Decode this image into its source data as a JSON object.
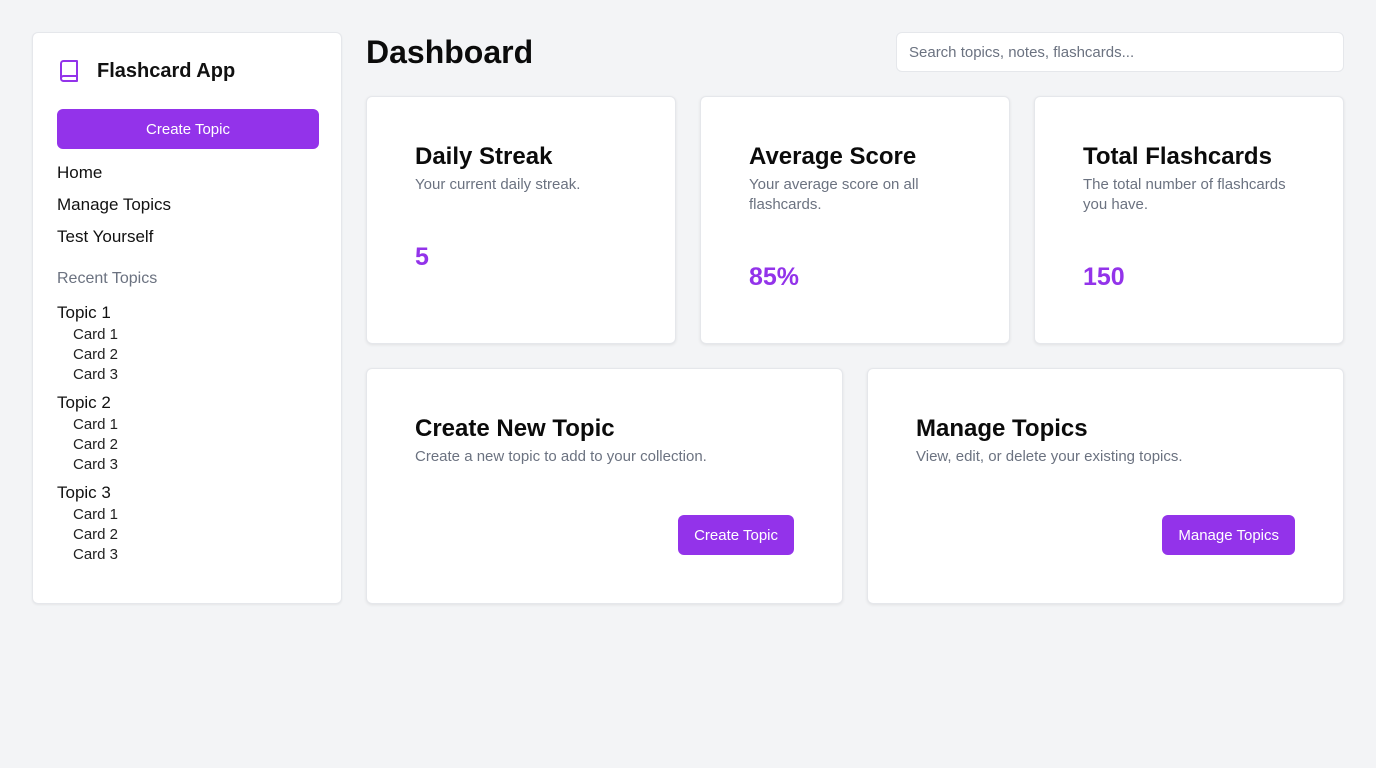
{
  "app": {
    "title": "Flashcard App",
    "icon": "book-icon",
    "accent_color": "#9333ea"
  },
  "sidebar": {
    "cta_label": "Create Topic",
    "nav": [
      {
        "label": "Home"
      },
      {
        "label": "Manage Topics"
      },
      {
        "label": "Test Yourself"
      }
    ],
    "recent_heading": "Recent Topics",
    "topics": [
      {
        "name": "Topic 1",
        "cards": [
          "Card 1",
          "Card 2",
          "Card 3"
        ]
      },
      {
        "name": "Topic 2",
        "cards": [
          "Card 1",
          "Card 2",
          "Card 3"
        ]
      },
      {
        "name": "Topic 3",
        "cards": [
          "Card 1",
          "Card 2",
          "Card 3"
        ]
      }
    ]
  },
  "header": {
    "title": "Dashboard",
    "search_placeholder": "Search topics, notes, flashcards...",
    "search_value": ""
  },
  "stats": [
    {
      "title": "Daily Streak",
      "desc": "Your current daily streak.",
      "value": "5"
    },
    {
      "title": "Average Score",
      "desc": "Your average score on all flashcards.",
      "value": "85%"
    },
    {
      "title": "Total Flashcards",
      "desc": "The total number of flashcards you have.",
      "value": "150"
    }
  ],
  "actions": [
    {
      "title": "Create New Topic",
      "desc": "Create a new topic to add to your collection.",
      "button": "Create Topic"
    },
    {
      "title": "Manage Topics",
      "desc": "View, edit, or delete your existing topics.",
      "button": "Manage Topics"
    }
  ]
}
